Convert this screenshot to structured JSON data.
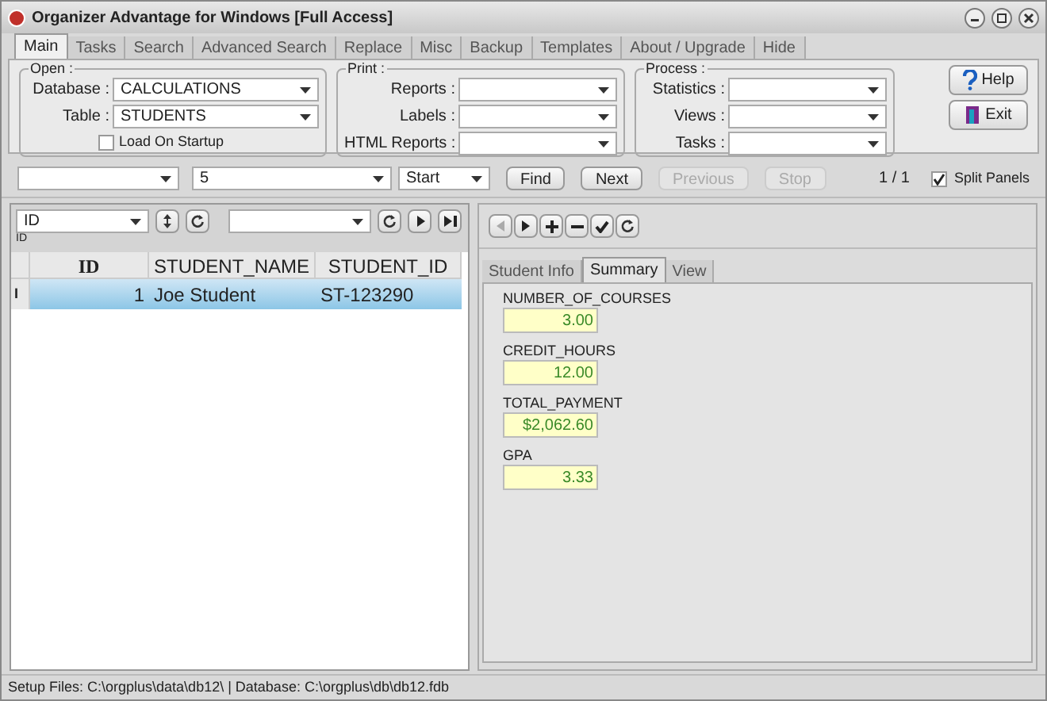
{
  "window": {
    "title": "Organizer Advantage for Windows [Full Access]"
  },
  "tabs": [
    {
      "label": "Main",
      "selected": true
    },
    {
      "label": "Tasks",
      "selected": false
    },
    {
      "label": "Search",
      "selected": false
    },
    {
      "label": "Advanced Search",
      "selected": false
    },
    {
      "label": "Replace",
      "selected": false
    },
    {
      "label": "Misc",
      "selected": false
    },
    {
      "label": "Backup",
      "selected": false
    },
    {
      "label": "Templates",
      "selected": false
    },
    {
      "label": "About / Upgrade",
      "selected": false
    },
    {
      "label": "Hide",
      "selected": false
    }
  ],
  "open_group": {
    "legend": "Open :",
    "fields": [
      {
        "label": "Database :",
        "value": "CALCULATIONS"
      },
      {
        "label": "Table :",
        "value": "STUDENTS"
      }
    ],
    "load_on_startup": {
      "label": "Load On Startup",
      "checked": false
    }
  },
  "print_group": {
    "legend": "Print :",
    "fields": [
      {
        "label": "Reports :"
      },
      {
        "label": "Labels :"
      },
      {
        "label": "HTML Reports :"
      }
    ]
  },
  "process_group": {
    "legend": "Process :",
    "fields": [
      {
        "label": "Statistics :"
      },
      {
        "label": "Views :"
      },
      {
        "label": "Tasks :"
      }
    ]
  },
  "side_buttons": [
    {
      "label": "Help",
      "kind": "help"
    },
    {
      "label": "Exit",
      "kind": "exit"
    }
  ],
  "search_bar": {
    "value_field": "5",
    "mode": "Start",
    "buttons": [
      {
        "label": "Find",
        "disabled": false
      },
      {
        "label": "Next",
        "disabled": false
      },
      {
        "label": "Previous",
        "disabled": true
      },
      {
        "label": "Stop",
        "disabled": true
      }
    ],
    "count": "1 / 1",
    "split_panels": {
      "label": "Split Panels",
      "checked": true
    }
  },
  "grid_toolbar": {
    "sort_field": "ID",
    "sort_caption": "ID"
  },
  "grid": {
    "columns": [
      "ID",
      "STUDENT_NAME",
      "STUDENT_ID"
    ],
    "rows": [
      {
        "marker": "I",
        "cells": [
          "1",
          "Joe Student",
          "ST-123290"
        ],
        "selected": true
      }
    ]
  },
  "record_tabs": [
    {
      "label": "Student Info",
      "selected": false
    },
    {
      "label": "Summary",
      "selected": true
    },
    {
      "label": "View",
      "selected": false
    }
  ],
  "summary_fields": [
    {
      "label": "NUMBER_OF_COURSES",
      "value": "3.00"
    },
    {
      "label": "CREDIT_HOURS",
      "value": "12.00"
    },
    {
      "label": "TOTAL_PAYMENT",
      "value": "$2,062.60"
    },
    {
      "label": "GPA",
      "value": "3.33"
    }
  ],
  "status_bar": "Setup Files: C:\\orgplus\\data\\db12\\ | Database: C:\\orgplus\\db\\db12.fdb"
}
